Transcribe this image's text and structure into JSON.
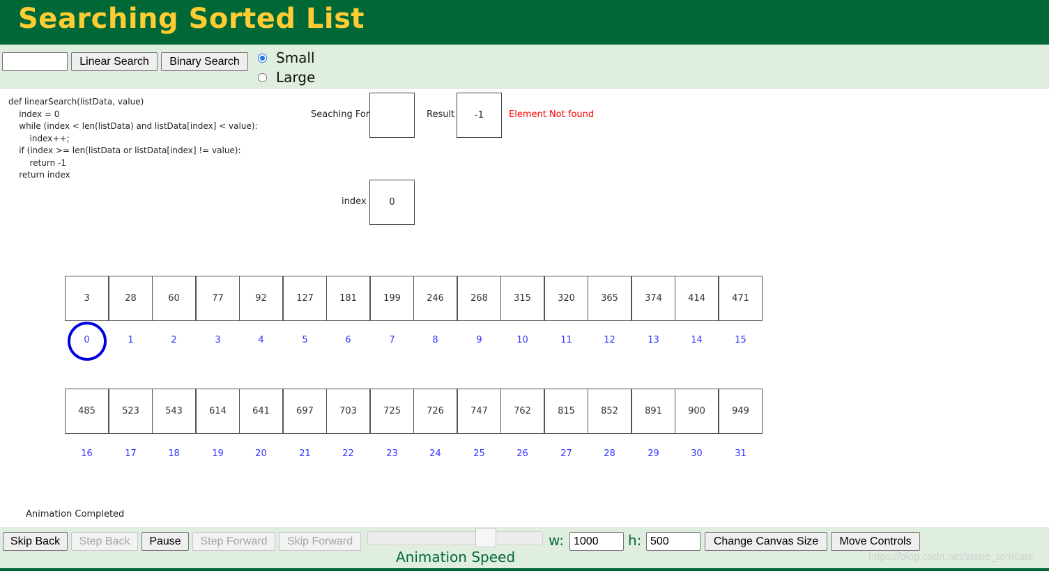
{
  "header": {
    "title": "Searching Sorted List",
    "bg_color": "#006837",
    "title_color": "#ffcc33"
  },
  "toolbar": {
    "search_value": "",
    "linear_search_label": "Linear Search",
    "binary_search_label": "Binary Search",
    "size_options": [
      {
        "label": "Small",
        "checked": true
      },
      {
        "label": "Large",
        "checked": false
      }
    ]
  },
  "code": {
    "lines": [
      "def linearSearch(listData, value)",
      "    index = 0",
      "    while (index < len(listData) and listData[index] < value):",
      "        index++;",
      "    if (index >= len(listData or listData[index] != value):",
      "        return -1",
      "    return index"
    ]
  },
  "vars": {
    "searching_for_label": "Seaching For",
    "searching_for_value": "",
    "result_label": "Result",
    "result_value": "-1",
    "result_message": "Element Not found",
    "index_label": "index",
    "index_value": "0"
  },
  "array": {
    "row1_values": [
      "3",
      "28",
      "60",
      "77",
      "92",
      "127",
      "181",
      "199",
      "246",
      "268",
      "315",
      "320",
      "365",
      "374",
      "414",
      "471"
    ],
    "row1_indices": [
      "0",
      "1",
      "2",
      "3",
      "4",
      "5",
      "6",
      "7",
      "8",
      "9",
      "10",
      "11",
      "12",
      "13",
      "14",
      "15"
    ],
    "row2_values": [
      "485",
      "523",
      "543",
      "614",
      "641",
      "697",
      "703",
      "725",
      "726",
      "747",
      "762",
      "815",
      "852",
      "891",
      "900",
      "949"
    ],
    "row2_indices": [
      "16",
      "17",
      "18",
      "19",
      "20",
      "21",
      "22",
      "23",
      "24",
      "25",
      "26",
      "27",
      "28",
      "29",
      "30",
      "31"
    ],
    "highlighted_index": 0
  },
  "status": {
    "text": "Animation Completed"
  },
  "controls": {
    "skip_back_label": "Skip Back",
    "step_back_label": "Step Back",
    "pause_label": "Pause",
    "step_forward_label": "Step Forward",
    "skip_forward_label": "Skip Forward",
    "speed_label": "Animation Speed",
    "speed_level": 0.7,
    "width_label": "w:",
    "width_value": "1000",
    "height_label": "h:",
    "height_value": "500",
    "change_canvas_label": "Change Canvas Size",
    "move_controls_label": "Move Controls"
  },
  "watermark": "https://blog.csdn.net/stone_tomcate"
}
